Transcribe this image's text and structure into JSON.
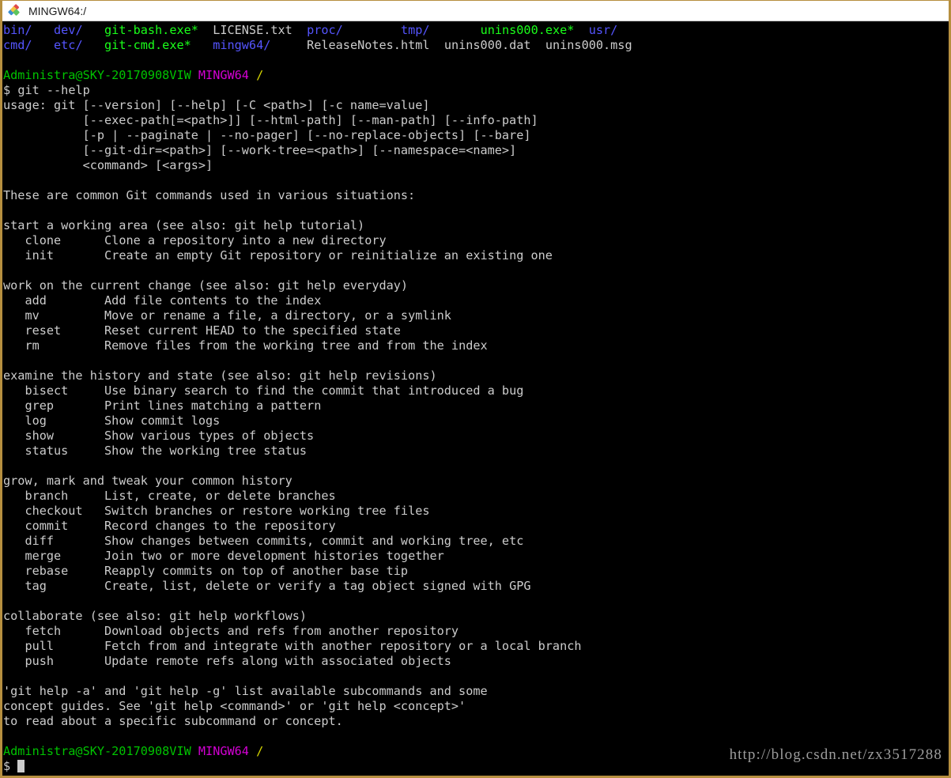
{
  "window": {
    "title": "MINGW64:/",
    "icon": "git-bash-icon",
    "border_color": "#b68f3f",
    "titlebar_bg": "#ffffff",
    "terminal_bg": "#000000"
  },
  "colors": {
    "default_text": "#cccccc",
    "directory": "#5555ff",
    "executable": "#1aff1a",
    "user_host": "#00c400",
    "shell_tag": "#d400d4",
    "path": "#d7d700"
  },
  "terminal": {
    "listing": {
      "row1": [
        {
          "text": "bin/",
          "color": "directory"
        },
        {
          "text": "dev/",
          "color": "directory"
        },
        {
          "text": "git-bash.exe*",
          "color": "executable"
        },
        {
          "text": "LICENSE.txt",
          "color": "default_text"
        },
        {
          "text": "proc/",
          "color": "directory"
        },
        {
          "text": "tmp/",
          "color": "directory"
        },
        {
          "text": "unins000.exe*",
          "color": "executable"
        },
        {
          "text": "usr/",
          "color": "directory"
        }
      ],
      "row2": [
        {
          "text": "cmd/",
          "color": "directory"
        },
        {
          "text": "etc/",
          "color": "directory"
        },
        {
          "text": "git-cmd.exe*",
          "color": "executable"
        },
        {
          "text": "mingw64/",
          "color": "directory"
        },
        {
          "text": "ReleaseNotes.html",
          "color": "default_text"
        },
        {
          "text": "unins000.dat",
          "color": "default_text"
        },
        {
          "text": "unins000.msg",
          "color": "default_text"
        }
      ],
      "line1_raw": "bin/   dev/   git-bash.exe*  LICENSE.txt  proc/        tmp/       unins000.exe*  usr/",
      "line2_raw": "cmd/   etc/   git-cmd.exe*   mingw64/     ReleaseNotes.html  unins000.dat  unins000.msg"
    },
    "prompt": {
      "user_host": "Administra@SKY-20170908VIW",
      "shell_tag": "MINGW64",
      "path": "/",
      "sigil": "$"
    },
    "command": "git --help",
    "usage_lines": [
      "usage: git [--version] [--help] [-C <path>] [-c name=value]",
      "           [--exec-path[=<path>]] [--html-path] [--man-path] [--info-path]",
      "           [-p | --paginate | --no-pager] [--no-replace-objects] [--bare]",
      "           [--git-dir=<path>] [--work-tree=<path>] [--namespace=<name>]",
      "           <command> [<args>]"
    ],
    "intro": "These are common Git commands used in various situations:",
    "groups": [
      {
        "heading": "start a working area (see also: git help tutorial)",
        "commands": [
          {
            "name": "clone",
            "desc": "Clone a repository into a new directory"
          },
          {
            "name": "init",
            "desc": "Create an empty Git repository or reinitialize an existing one"
          }
        ]
      },
      {
        "heading": "work on the current change (see also: git help everyday)",
        "commands": [
          {
            "name": "add",
            "desc": "Add file contents to the index"
          },
          {
            "name": "mv",
            "desc": "Move or rename a file, a directory, or a symlink"
          },
          {
            "name": "reset",
            "desc": "Reset current HEAD to the specified state"
          },
          {
            "name": "rm",
            "desc": "Remove files from the working tree and from the index"
          }
        ]
      },
      {
        "heading": "examine the history and state (see also: git help revisions)",
        "commands": [
          {
            "name": "bisect",
            "desc": "Use binary search to find the commit that introduced a bug"
          },
          {
            "name": "grep",
            "desc": "Print lines matching a pattern"
          },
          {
            "name": "log",
            "desc": "Show commit logs"
          },
          {
            "name": "show",
            "desc": "Show various types of objects"
          },
          {
            "name": "status",
            "desc": "Show the working tree status"
          }
        ]
      },
      {
        "heading": "grow, mark and tweak your common history",
        "commands": [
          {
            "name": "branch",
            "desc": "List, create, or delete branches"
          },
          {
            "name": "checkout",
            "desc": "Switch branches or restore working tree files"
          },
          {
            "name": "commit",
            "desc": "Record changes to the repository"
          },
          {
            "name": "diff",
            "desc": "Show changes between commits, commit and working tree, etc"
          },
          {
            "name": "merge",
            "desc": "Join two or more development histories together"
          },
          {
            "name": "rebase",
            "desc": "Reapply commits on top of another base tip"
          },
          {
            "name": "tag",
            "desc": "Create, list, delete or verify a tag object signed with GPG"
          }
        ]
      },
      {
        "heading": "collaborate (see also: git help workflows)",
        "commands": [
          {
            "name": "fetch",
            "desc": "Download objects and refs from another repository"
          },
          {
            "name": "pull",
            "desc": "Fetch from and integrate with another repository or a local branch"
          },
          {
            "name": "push",
            "desc": "Update remote refs along with associated objects"
          }
        ]
      }
    ],
    "footer_lines": [
      "'git help -a' and 'git help -g' list available subcommands and some",
      "concept guides. See 'git help <command>' or 'git help <concept>'",
      "to read about a specific subcommand or concept."
    ]
  },
  "watermark": "http://blog.csdn.net/zx3517288"
}
